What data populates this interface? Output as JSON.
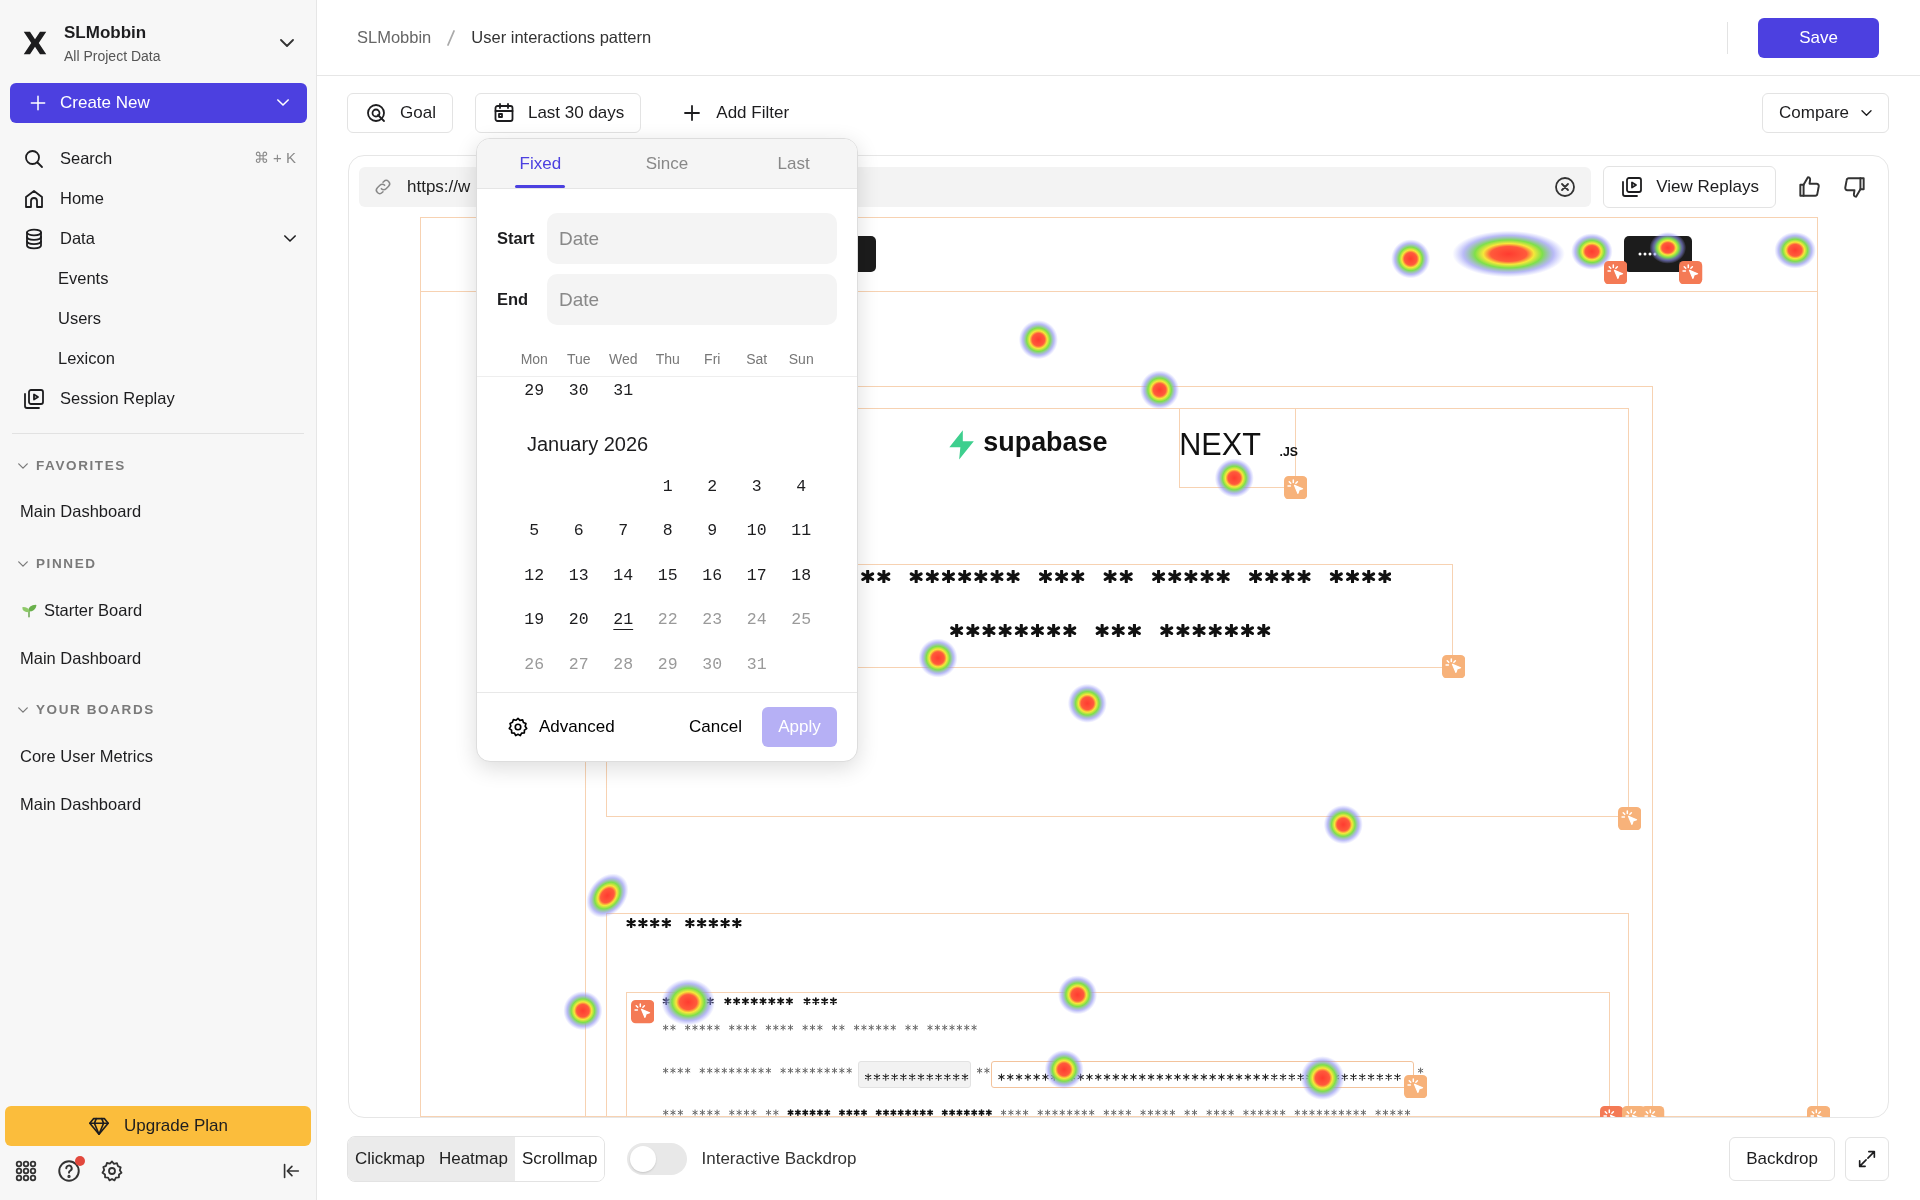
{
  "sidebar": {
    "workspace": {
      "name": "SLMobbin",
      "subtitle": "All Project Data"
    },
    "create_button": "Create New",
    "nav": [
      {
        "label": "Search",
        "shortcut": "⌘ + K"
      },
      {
        "label": "Home"
      },
      {
        "label": "Data",
        "expanded": true,
        "children": [
          {
            "label": "Events"
          },
          {
            "label": "Users"
          },
          {
            "label": "Lexicon"
          }
        ]
      },
      {
        "label": "Session Replay"
      }
    ],
    "sections": [
      {
        "title": "FAVORITES",
        "expanded": true,
        "items": [
          {
            "label": "Main Dashboard"
          }
        ]
      },
      {
        "title": "PINNED",
        "expanded": true,
        "items": [
          {
            "label": "Starter Board"
          },
          {
            "label": "Main Dashboard"
          }
        ]
      },
      {
        "title": "YOUR BOARDS",
        "expanded": true,
        "items": [
          {
            "label": "Core User Metrics"
          },
          {
            "label": "Main Dashboard"
          }
        ]
      }
    ],
    "upgrade_button": "Upgrade Plan",
    "help_notification": true
  },
  "breadcrumb": [
    "SLMobbin",
    "User interactions pattern"
  ],
  "save_button": "Save",
  "toolbar": {
    "goal": "Goal",
    "date_range": "Last 30 days",
    "add_filter": "Add Filter",
    "compare": "Compare"
  },
  "url_bar": {
    "value": "https://w"
  },
  "view_replays": "View Replays",
  "heatmap_page": {
    "texts": [
      {
        "text": "supabase"
      },
      {
        "text": "NEXT"
      },
      {
        "text": ".JS"
      }
    ]
  },
  "date_picker": {
    "tabs": [
      {
        "label": "Fixed",
        "selected": true
      },
      {
        "label": "Since",
        "selected": false
      },
      {
        "label": "Last",
        "selected": false
      }
    ],
    "start": {
      "label": "Start",
      "placeholder": "Date"
    },
    "end": {
      "label": "End",
      "placeholder": "Date"
    },
    "weekdays": [
      "Mon",
      "Tue",
      "Wed",
      "Thu",
      "Fri",
      "Sat",
      "Sun"
    ],
    "previous_month_tail": [
      "29",
      "30",
      "31"
    ],
    "month": "January 2026",
    "weeks": [
      [
        {
          "label": "1",
          "disabled": false,
          "today": false
        },
        {
          "label": "2",
          "disabled": false,
          "today": false
        },
        {
          "label": "3",
          "disabled": false,
          "today": false
        },
        {
          "label": "4",
          "disabled": false,
          "today": false
        }
      ],
      [
        {
          "label": "5",
          "disabled": false,
          "today": false
        },
        {
          "label": "6",
          "disabled": false,
          "today": false
        },
        {
          "label": "7",
          "disabled": false,
          "today": false
        },
        {
          "label": "8",
          "disabled": false,
          "today": false
        },
        {
          "label": "9",
          "disabled": false,
          "today": false
        },
        {
          "label": "10",
          "disabled": false,
          "today": false
        },
        {
          "label": "11",
          "disabled": false,
          "today": false
        }
      ],
      [
        {
          "label": "12",
          "disabled": false,
          "today": false
        },
        {
          "label": "13",
          "disabled": false,
          "today": false
        },
        {
          "label": "14",
          "disabled": false,
          "today": false
        },
        {
          "label": "15",
          "disabled": false,
          "today": false
        },
        {
          "label": "16",
          "disabled": false,
          "today": false
        },
        {
          "label": "17",
          "disabled": false,
          "today": false
        },
        {
          "label": "18",
          "disabled": false,
          "today": false
        }
      ],
      [
        {
          "label": "19",
          "disabled": false,
          "today": false
        },
        {
          "label": "20",
          "disabled": false,
          "today": false
        },
        {
          "label": "21",
          "disabled": false,
          "today": true
        },
        {
          "label": "22",
          "disabled": true,
          "today": false
        },
        {
          "label": "23",
          "disabled": true,
          "today": false
        },
        {
          "label": "24",
          "disabled": true,
          "today": false
        },
        {
          "label": "25",
          "disabled": true,
          "today": false
        }
      ],
      [
        {
          "label": "26",
          "disabled": true,
          "today": false
        },
        {
          "label": "27",
          "disabled": true,
          "today": false
        },
        {
          "label": "28",
          "disabled": true,
          "today": false
        },
        {
          "label": "29",
          "disabled": true,
          "today": false
        },
        {
          "label": "30",
          "disabled": true,
          "today": false
        },
        {
          "label": "31",
          "disabled": true,
          "today": false
        }
      ]
    ],
    "advanced": "Advanced",
    "cancel": "Cancel",
    "apply": {
      "label": "Apply",
      "disabled": true
    }
  },
  "bottom_bar": {
    "view_modes": [
      {
        "label": "Clickmap",
        "selected": false
      },
      {
        "label": "Heatmap",
        "selected": false
      },
      {
        "label": "Scrollmap",
        "selected": true
      }
    ],
    "backdrop_toggle": {
      "label": "Interactive Backdrop",
      "on": false
    },
    "backdrop_button": "Backdrop"
  }
}
